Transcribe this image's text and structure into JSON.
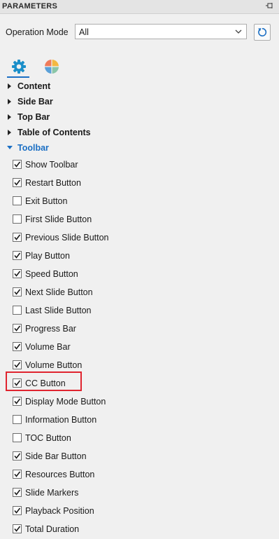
{
  "panel": {
    "title": "PARAMETERS"
  },
  "operation_mode": {
    "label": "Operation Mode",
    "value": "All"
  },
  "tabs": [
    {
      "name": "settings",
      "icon": "gear-icon",
      "active": true
    },
    {
      "name": "theme",
      "icon": "color-wheel-icon",
      "active": false
    }
  ],
  "sections": [
    {
      "label": "Content",
      "expanded": false
    },
    {
      "label": "Side Bar",
      "expanded": false
    },
    {
      "label": "Top Bar",
      "expanded": false
    },
    {
      "label": "Table of Contents",
      "expanded": false
    },
    {
      "label": "Toolbar",
      "expanded": true
    }
  ],
  "toolbar_items": [
    {
      "label": "Show Toolbar",
      "checked": true
    },
    {
      "label": "Restart Button",
      "checked": true
    },
    {
      "label": "Exit Button",
      "checked": false
    },
    {
      "label": "First Slide Button",
      "checked": false
    },
    {
      "label": "Previous Slide Button",
      "checked": true
    },
    {
      "label": "Play Button",
      "checked": true
    },
    {
      "label": "Speed Button",
      "checked": true
    },
    {
      "label": "Next Slide Button",
      "checked": true
    },
    {
      "label": "Last Slide Button",
      "checked": false
    },
    {
      "label": "Progress Bar",
      "checked": true
    },
    {
      "label": "Volume Bar",
      "checked": true
    },
    {
      "label": "Volume Button",
      "checked": true
    },
    {
      "label": "CC Button",
      "checked": true,
      "highlighted": true
    },
    {
      "label": "Display Mode Button",
      "checked": true
    },
    {
      "label": "Information Button",
      "checked": false
    },
    {
      "label": "TOC Button",
      "checked": false
    },
    {
      "label": "Side Bar Button",
      "checked": true
    },
    {
      "label": "Resources Button",
      "checked": true
    },
    {
      "label": "Slide Markers",
      "checked": true
    },
    {
      "label": "Playback Position",
      "checked": true
    },
    {
      "label": "Total Duration",
      "checked": true
    }
  ],
  "colors": {
    "accent": "#1b6fc4",
    "highlight": "#e0242f",
    "background": "#f0f0f0"
  }
}
